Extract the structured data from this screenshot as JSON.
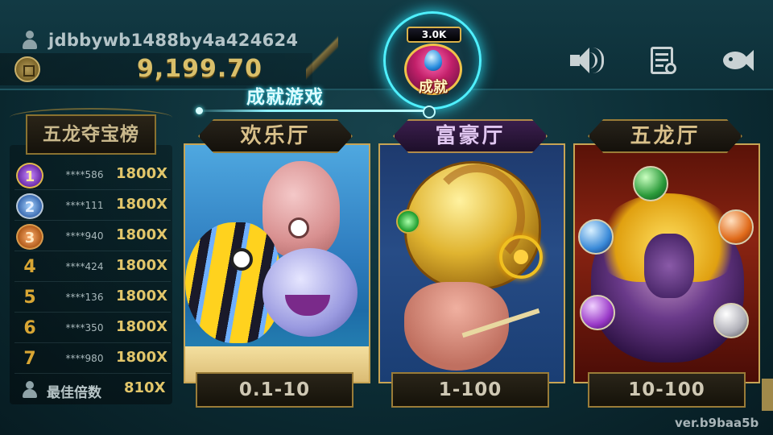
{
  "player": {
    "username": "jdbbywb1488by4a424624",
    "balance": "9,199.70"
  },
  "achievement": {
    "count": "3.0K",
    "badge_label": "成就",
    "link_text": "成就游戏"
  },
  "top_icons": [
    "sound-icon",
    "record-icon",
    "fish-icon"
  ],
  "leaderboard": {
    "title": "五龙夺宝榜",
    "rows": [
      {
        "rank": "1",
        "user": "****586",
        "multiplier": "1800X"
      },
      {
        "rank": "2",
        "user": "****111",
        "multiplier": "1800X"
      },
      {
        "rank": "3",
        "user": "****940",
        "multiplier": "1800X"
      },
      {
        "rank": "4",
        "user": "****424",
        "multiplier": "1800X"
      },
      {
        "rank": "5",
        "user": "****136",
        "multiplier": "1800X"
      },
      {
        "rank": "6",
        "user": "****350",
        "multiplier": "1800X"
      },
      {
        "rank": "7",
        "user": "****980",
        "multiplier": "1800X"
      }
    ],
    "best": {
      "label": "最佳倍数",
      "multiplier": "810X"
    }
  },
  "rooms": [
    {
      "name": "欢乐厅",
      "range": "0.1-10"
    },
    {
      "name": "富豪厅",
      "range": "1-100"
    },
    {
      "name": "五龙厅",
      "range": "10-100"
    }
  ],
  "version": "ver.b9baa5b",
  "colors": {
    "gold": "#e2c66a",
    "cyan_glow": "#4ff0ff",
    "background": "#0c2d35"
  }
}
